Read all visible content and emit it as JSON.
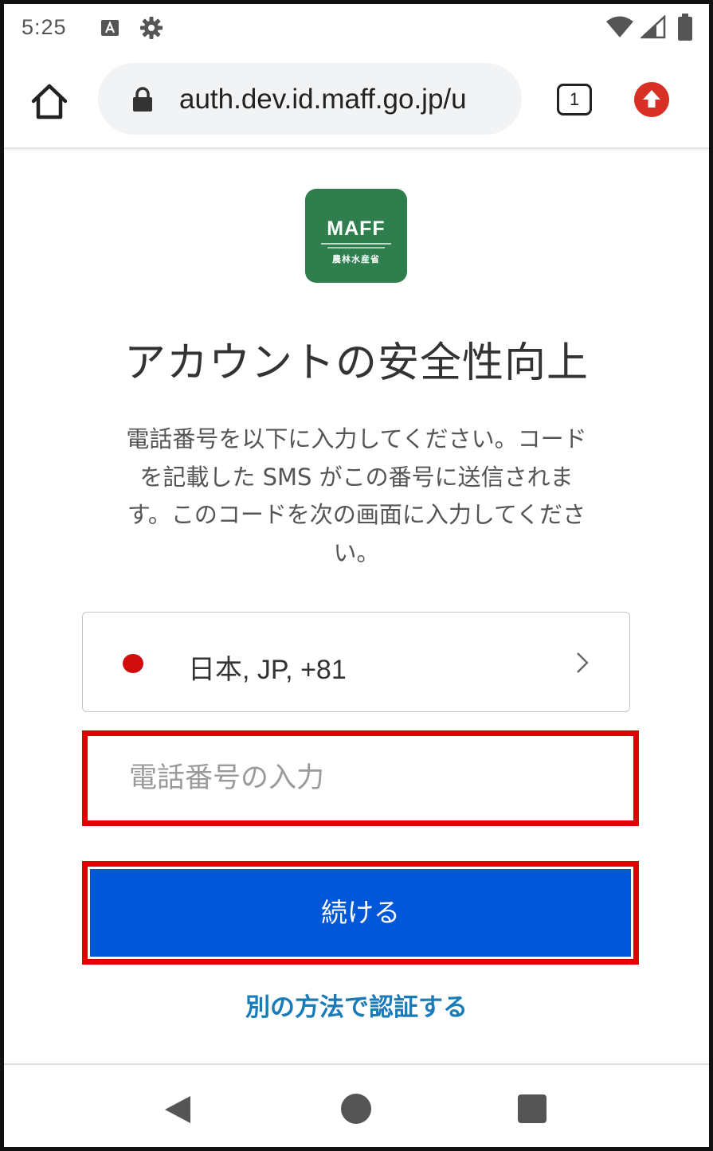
{
  "status_bar": {
    "time": "5:25",
    "icons": [
      "notification-a-icon",
      "gear-icon",
      "wifi-icon",
      "signal-icon",
      "battery-icon"
    ]
  },
  "browser": {
    "url": "auth.dev.id.maff.go.jp/u",
    "tab_count": "1",
    "icons": [
      "home-icon",
      "lock-icon",
      "tabs-icon",
      "update-icon"
    ]
  },
  "logo": {
    "text": "MAFF",
    "japanese": "農林水産省",
    "color": "#2f7f4e"
  },
  "main": {
    "title": "アカウントの安全性向上",
    "description_lines": [
      "電話番号を以下に入力してください。コード",
      "を記載した SMS がこの番号に送信されま",
      "す。このコードを次の画面に入力してくださ",
      "い。"
    ],
    "country_selector": {
      "value": "日本, JP, +81",
      "flag_color": "#d00c0c"
    },
    "phone_input": {
      "value": "",
      "placeholder": "電話番号の入力"
    },
    "continue_label": "続ける",
    "alt_method_label": "別の方法で認証する"
  },
  "colors": {
    "primary_button": "#0057d8",
    "link": "#1a7bb9",
    "highlight_border": "#e00000"
  },
  "nav_bar": {
    "icons": [
      "back-icon",
      "home-circle-icon",
      "recents-icon"
    ]
  }
}
